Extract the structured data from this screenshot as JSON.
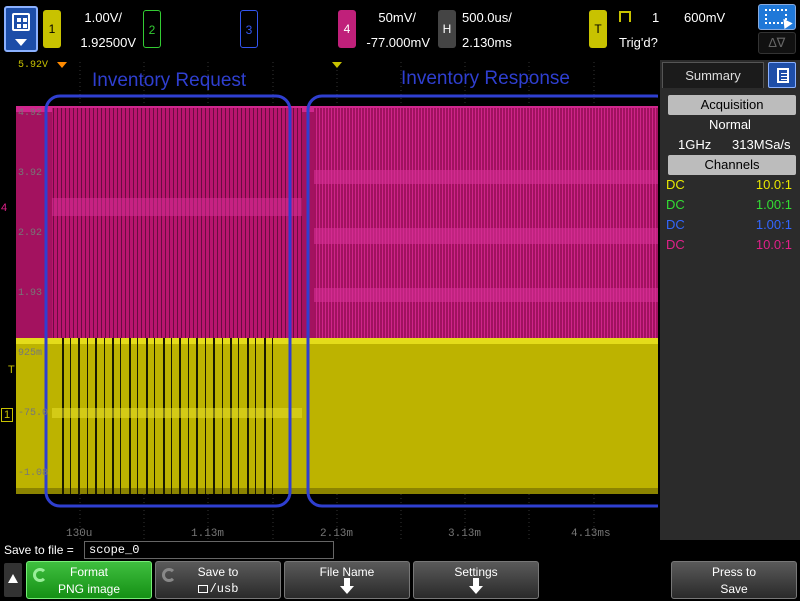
{
  "top": {
    "ch1": {
      "num": "1",
      "scale": "1.00V/",
      "offset": "1.92500V",
      "color": "#c8c200"
    },
    "ch2": {
      "num": "2",
      "color": "#33cc33"
    },
    "ch3": {
      "num": "3",
      "color": "#3355ee"
    },
    "ch4": {
      "num": "4",
      "scale": "50mV/",
      "offset": "-77.000mV",
      "color": "#c0207a"
    },
    "horizontal": {
      "label": "H",
      "timebase": "500.0us/",
      "delay": "2.130ms"
    },
    "trigger": {
      "label": "T",
      "source": "1",
      "level": "600mV",
      "status": "Trig'd?"
    },
    "right_btn_bottom": "∆∇"
  },
  "graticule": {
    "y_labels": [
      "5.92V",
      "4.92",
      "3.92",
      "2.92",
      "1.93",
      "925m",
      "-75.0",
      "-1.08"
    ],
    "x_labels": [
      "130u",
      "1.13m",
      "2.13m",
      "3.13m",
      "4.13ms"
    ],
    "ch4_marker": "4",
    "trig_marker": "T",
    "ch1_marker": "1",
    "annotations": [
      {
        "label": "Inventory Request",
        "color": "#2f3fd0"
      },
      {
        "label": "Inventory Response",
        "color": "#2f3fd0"
      }
    ]
  },
  "panel": {
    "tab": "Summary",
    "acq_header": "Acquisition",
    "acq_mode": "Normal",
    "bandwidth": "1GHz",
    "sample_rate": "313MSa/s",
    "channels_header": "Channels",
    "channels": [
      {
        "coupling": "DC",
        "probe": "10.0:1",
        "color": "#e8e800"
      },
      {
        "coupling": "DC",
        "probe": "1.00:1",
        "color": "#33dd33"
      },
      {
        "coupling": "DC",
        "probe": "1.00:1",
        "color": "#3366ff"
      },
      {
        "coupling": "DC",
        "probe": "10.0:1",
        "color": "#e0208a"
      }
    ]
  },
  "save": {
    "label": "Save to file =",
    "filename": "scope_0"
  },
  "softkeys": {
    "format": {
      "l1": "Format",
      "l2": "PNG image"
    },
    "save_to": {
      "l1": "Save to",
      "l2": "/usb"
    },
    "file_name": {
      "l1": "File Name"
    },
    "settings": {
      "l1": "Settings"
    },
    "press": {
      "l1": "Press to",
      "l2": "Save"
    }
  }
}
